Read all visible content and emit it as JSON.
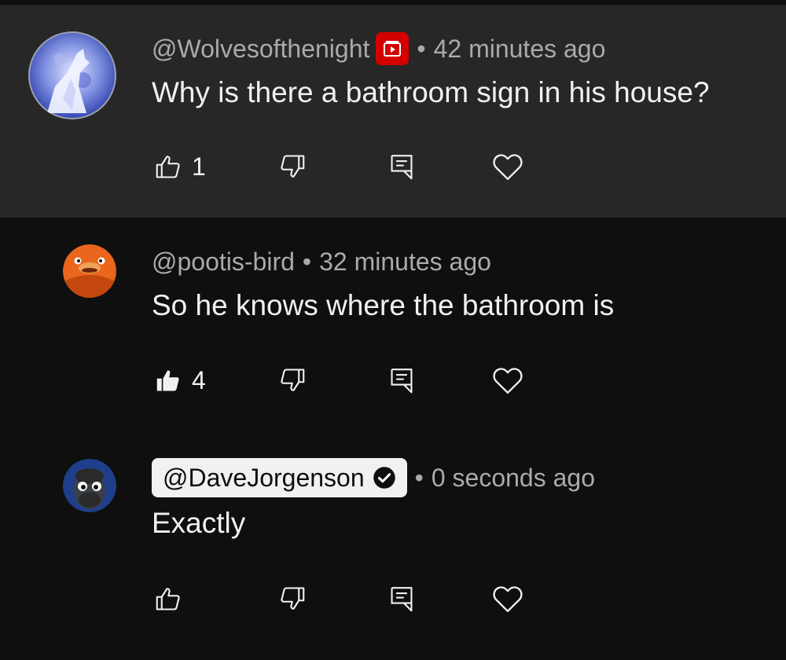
{
  "comments": [
    {
      "author": "@Wolvesofthenight",
      "time": "42 minutes ago",
      "text": "Why is there a bathroom sign in his house?",
      "like_count": "1",
      "liked": false,
      "has_member_badge": true,
      "highlighted": true
    },
    {
      "author": "@pootis-bird",
      "time": "32 minutes ago",
      "text": "So he knows where the bathroom is",
      "like_count": "4",
      "liked": true,
      "has_member_badge": false
    },
    {
      "author": "@DaveJorgenson",
      "time": "0 seconds ago",
      "text": "Exactly",
      "like_count": "",
      "liked": false,
      "creator": true,
      "verified": true
    }
  ],
  "separator": "•",
  "colors": {
    "background": "#0f0f0f",
    "highlight_background": "#272727",
    "primary_text": "#f1f1f1",
    "secondary_text": "#aaaaaa",
    "member_badge": "#d40000",
    "creator_chip": "#f1f1f1"
  },
  "icons": {
    "like": "thumb-up-outline-icon",
    "like_active": "thumb-up-filled-icon",
    "dislike": "thumb-down-outline-icon",
    "reply": "reply-comment-icon",
    "heart": "heart-outline-icon",
    "badge": "member-badge-icon",
    "verified": "verified-check-icon"
  }
}
